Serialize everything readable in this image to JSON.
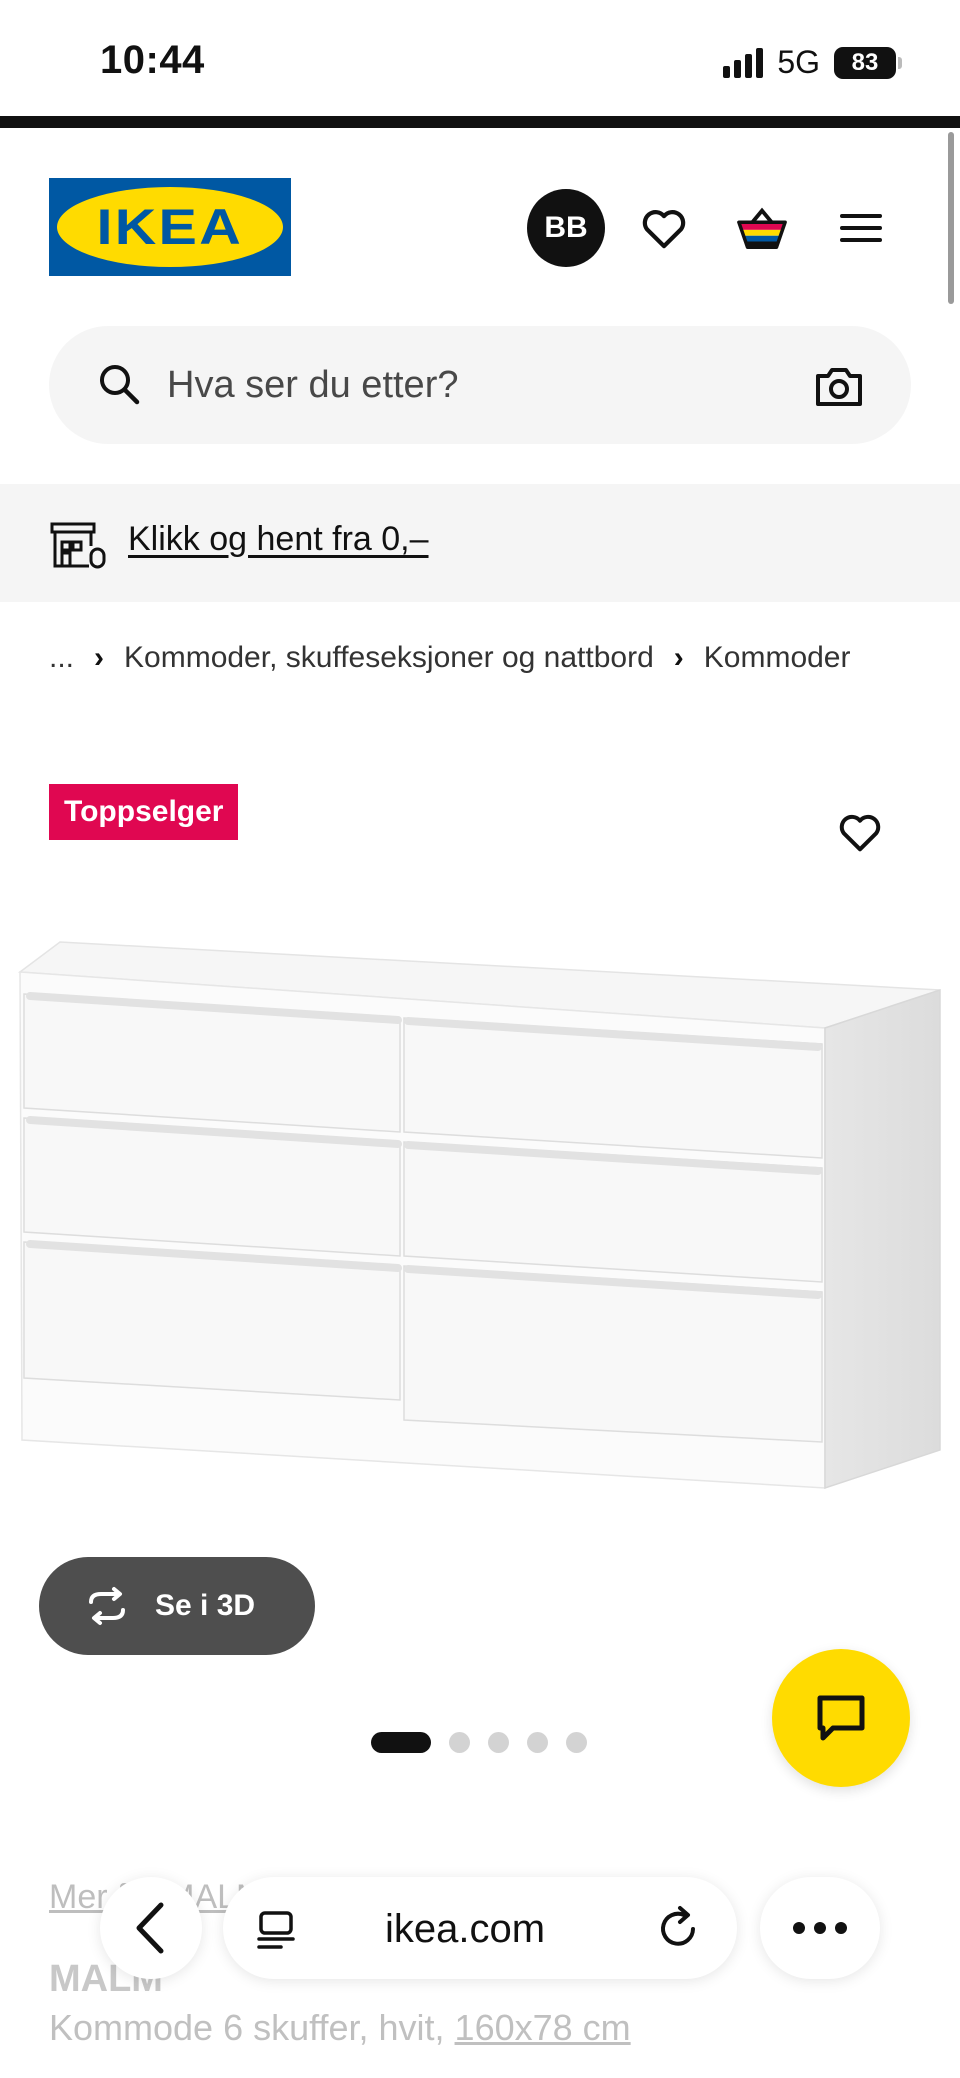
{
  "status_bar": {
    "time": "10:44",
    "network": "5G",
    "battery": "83"
  },
  "header": {
    "logo_text": "IKEA",
    "avatar_initials": "BB",
    "icons": [
      "heart-icon",
      "basket-icon",
      "menu-icon"
    ]
  },
  "search": {
    "placeholder": "Hva ser du etter?"
  },
  "promo": {
    "link": "Klikk og hent fra 0,–"
  },
  "breadcrumb": {
    "ellipsis": "...",
    "items": [
      "Kommoder, skuffeseksjoner og nattbord",
      "Kommoder"
    ]
  },
  "product": {
    "badge": "Toppselger",
    "view_3d_label": "Se i 3D",
    "carousel": {
      "count": 5,
      "active": 1
    },
    "more_link": "Mer fra MALM-serien",
    "name": "MALM",
    "description": "Kommode 6 skuffer, hvit,",
    "dimensions": "160x78 cm"
  },
  "browser": {
    "url": "ikea.com"
  },
  "colors": {
    "ikea_blue": "#0058a3",
    "ikea_yellow": "#ffdb00",
    "badge_red": "#e00751",
    "chat_fab": "#ffdb00"
  }
}
